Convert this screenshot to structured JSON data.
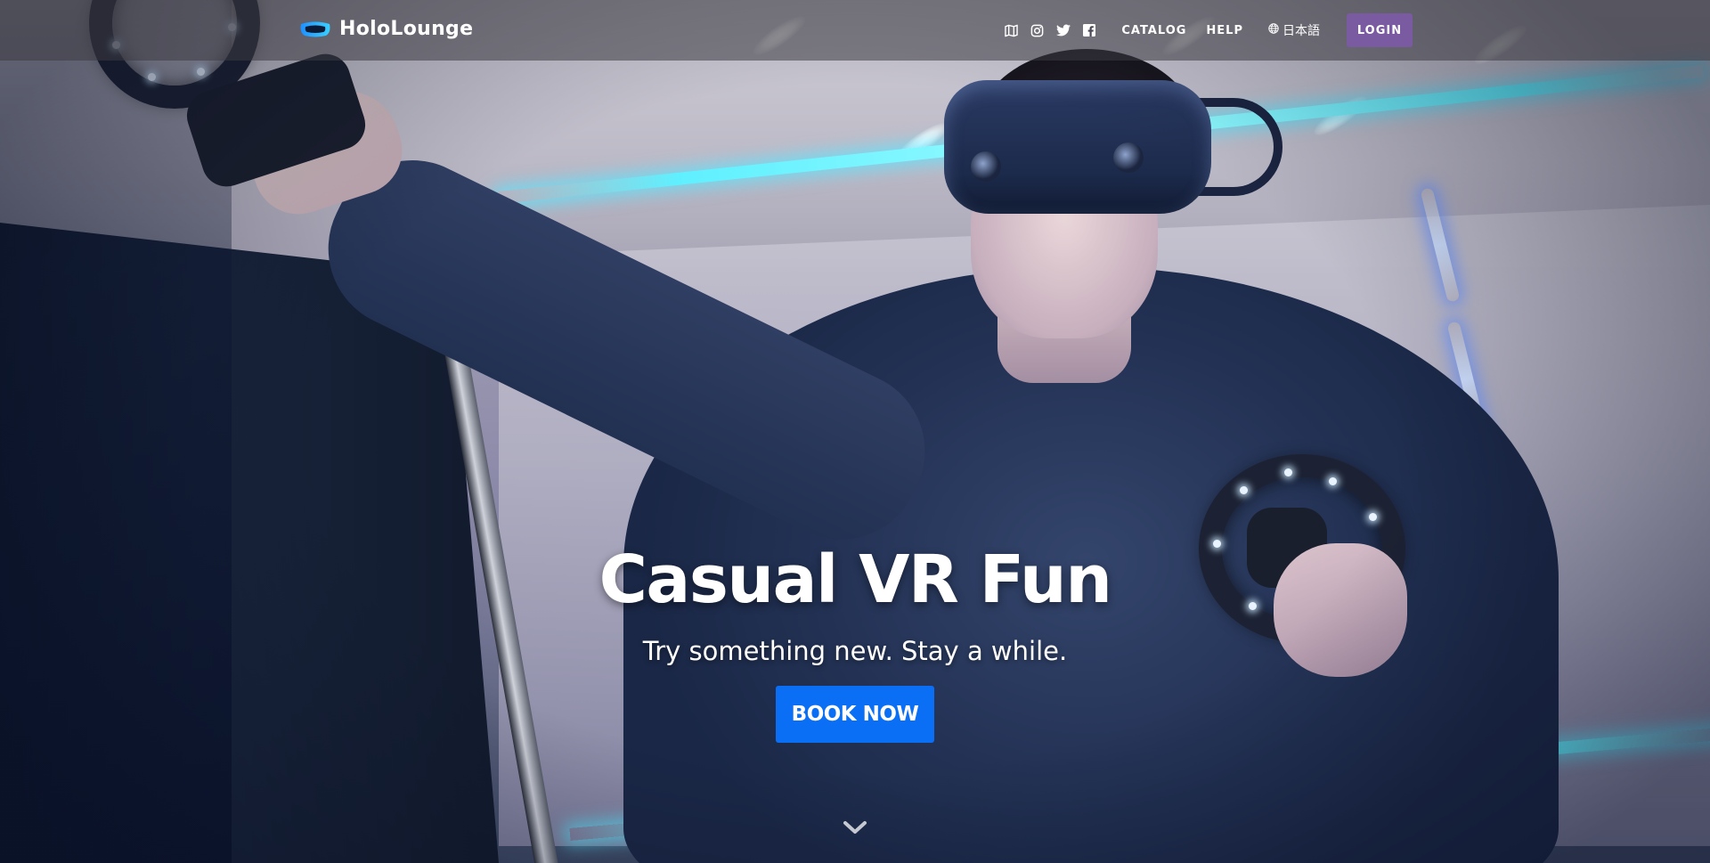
{
  "brand": {
    "name": "HoloLounge",
    "logo_icon": "visor-logo-icon",
    "logo_colors": [
      "#1e90ff",
      "#3ad0ff"
    ]
  },
  "nav": {
    "icons": [
      {
        "name": "map-icon",
        "label": "map"
      },
      {
        "name": "instagram-icon",
        "label": "instagram"
      },
      {
        "name": "twitter-icon",
        "label": "twitter"
      },
      {
        "name": "facebook-icon",
        "label": "facebook"
      }
    ],
    "links": [
      {
        "label": "CATALOG"
      },
      {
        "label": "HELP"
      }
    ],
    "language": {
      "icon": "globe-icon",
      "label": "日本語"
    },
    "login_label": "LOGIN"
  },
  "hero": {
    "title": "Casual VR Fun",
    "subtitle": "Try something new. Stay a while.",
    "cta_label": "BOOK NOW",
    "scroll_icon": "chevron-down-icon"
  },
  "colors": {
    "cta": "#0a6ff5",
    "login": "#7a5aa0",
    "navbar": "rgba(60,58,66,0.55)",
    "accent_neon": "#5ff0ff"
  }
}
